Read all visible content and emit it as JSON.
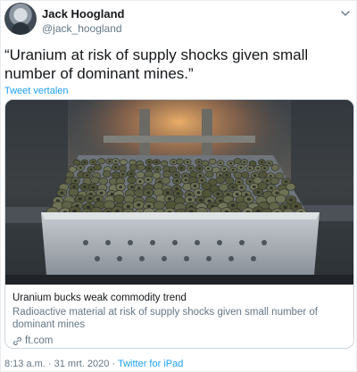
{
  "author": {
    "display_name": "Jack Hoogland",
    "handle": "@jack_hoogland"
  },
  "tweet": {
    "text": "“Uranium at risk of supply shocks given small number of dominant mines.”",
    "translate_label": "Tweet vertalen"
  },
  "card": {
    "title": "Uranium bucks weak commodity trend",
    "description": "Radioactive material at risk of supply shocks given small number of dominant mines",
    "domain": "ft.com"
  },
  "footer": {
    "time": "8:13 a.m.",
    "separator": " · ",
    "date": "31 mrt. 2020",
    "source": "Twitter for iPad"
  },
  "icons": {
    "caret": "chevron-down-icon",
    "link": "link-icon"
  },
  "colors": {
    "link_blue": "#1da1f2",
    "muted_gray": "#657786",
    "text": "#14171a",
    "border": "#ccd6dd"
  }
}
